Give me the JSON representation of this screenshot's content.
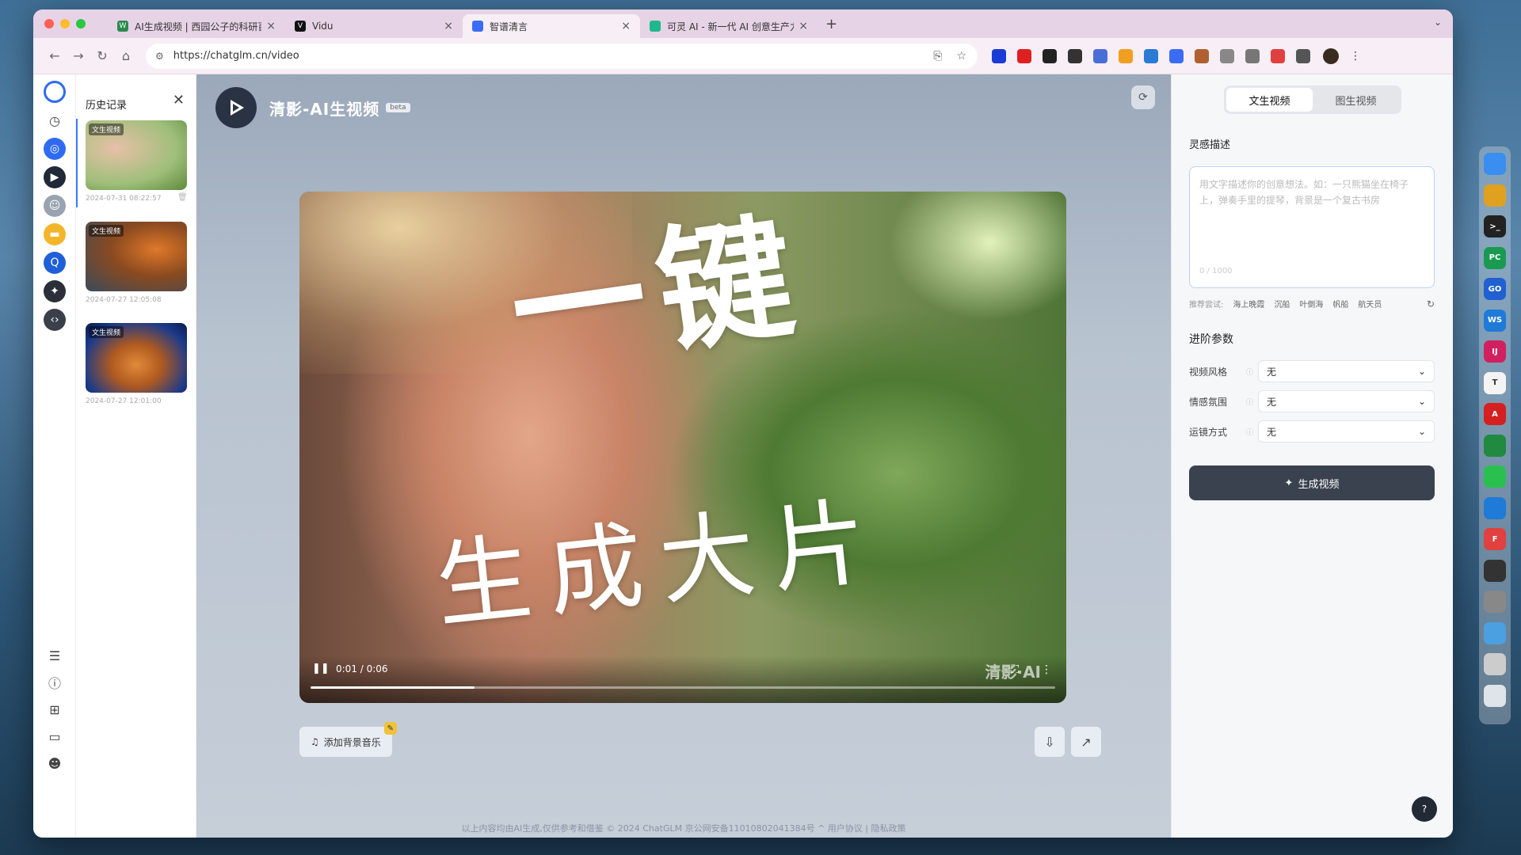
{
  "browser": {
    "tabs": [
      {
        "title": "AI生成视频 | 西园公子的科研百",
        "fav_color": "#2d8a4e",
        "fav_glyph": "W",
        "active": false
      },
      {
        "title": "Vidu",
        "fav_color": "#111111",
        "fav_glyph": "V",
        "active": false
      },
      {
        "title": "智谱清言",
        "fav_color": "#3b6cf6",
        "fav_glyph": "",
        "active": true
      },
      {
        "title": "可灵 AI - 新一代 AI 创意生产力",
        "fav_color": "#1fb88a",
        "fav_glyph": "",
        "active": false
      }
    ],
    "url": "https://chatglm.cn/video",
    "extensions": [
      "#1a3bd6",
      "#e02020",
      "#222222",
      "#333333",
      "#4b6ed6",
      "#f0a020",
      "#2a7ad6",
      "#3b6cf6",
      "#b06030",
      "#888888",
      "#777777",
      "#e04040",
      "#555555"
    ]
  },
  "history": {
    "title": "历史记录",
    "items": [
      {
        "badge": "文生视频",
        "date": "2024-07-31 08:22:57"
      },
      {
        "badge": "文生视频",
        "date": "2024-07-27 12:05:08"
      },
      {
        "badge": "文生视频",
        "date": "2024-07-27 12:01:00"
      }
    ]
  },
  "brand": {
    "name": "清影-AI生视频",
    "beta": "beta"
  },
  "video": {
    "overlay_title": "一键",
    "overlay_subtitle": "生成大片",
    "time": "0:01 / 0:06",
    "progress_fraction": 0.22,
    "watermark": "清影·AI"
  },
  "actions": {
    "music_label": "添加背景音乐"
  },
  "footer": {
    "text": "以上内容均由AI生成,仅供参考和借鉴    © 2024 ChatGLM 京公网安备11010802041384号 ^    用户协议  |  隐私政策"
  },
  "panel": {
    "tabs": [
      "文生视频",
      "图生视频"
    ],
    "inspiration_label": "灵感描述",
    "prompt_placeholder": "用文字描述你的创意想法。如：一只熊猫坐在椅子上，弹奏手里的提琴，背景是一个复古书房",
    "prompt_count": "0 / 1000",
    "suggest_label": "推荐尝试:",
    "suggestions": [
      "海上晚霞",
      "沉船",
      "叶倒海",
      "帆船",
      "航天员"
    ],
    "advanced_label": "进阶参数",
    "params": [
      {
        "name": "视频风格",
        "value": "无"
      },
      {
        "name": "情感氛围",
        "value": "无"
      },
      {
        "name": "运镜方式",
        "value": "无"
      }
    ],
    "generate_label": "生成视频"
  },
  "dock": {
    "apps": [
      {
        "name": "finder",
        "color": "#3a8ef0",
        "glyph": ""
      },
      {
        "name": "chrome",
        "color": "#e0a020",
        "glyph": ""
      },
      {
        "name": "terminal",
        "color": "#222222",
        "glyph": ">_"
      },
      {
        "name": "pycharm",
        "color": "#1a9a50",
        "glyph": "PC"
      },
      {
        "name": "goland",
        "color": "#2060d0",
        "glyph": "GO"
      },
      {
        "name": "webstorm",
        "color": "#1f7ad8",
        "glyph": "WS"
      },
      {
        "name": "intellij",
        "color": "#d02060",
        "glyph": "IJ"
      },
      {
        "name": "typora",
        "color": "#f4f4f4",
        "glyph": "T"
      },
      {
        "name": "acrobat",
        "color": "#d42020",
        "glyph": "A"
      },
      {
        "name": "mongodb",
        "color": "#1f8a40",
        "glyph": ""
      },
      {
        "name": "wechat",
        "color": "#2ac050",
        "glyph": ""
      },
      {
        "name": "vscode",
        "color": "#1f7ad8",
        "glyph": ""
      },
      {
        "name": "feishu",
        "color": "#e04040",
        "glyph": "F"
      },
      {
        "name": "clock",
        "color": "#333333",
        "glyph": ""
      },
      {
        "name": "settings",
        "color": "#888888",
        "glyph": ""
      },
      {
        "name": "preview",
        "color": "#4aa0e0",
        "glyph": ""
      },
      {
        "name": "photo",
        "color": "#cccccc",
        "glyph": ""
      },
      {
        "name": "trash",
        "color": "#dfe4ea",
        "glyph": ""
      }
    ]
  }
}
